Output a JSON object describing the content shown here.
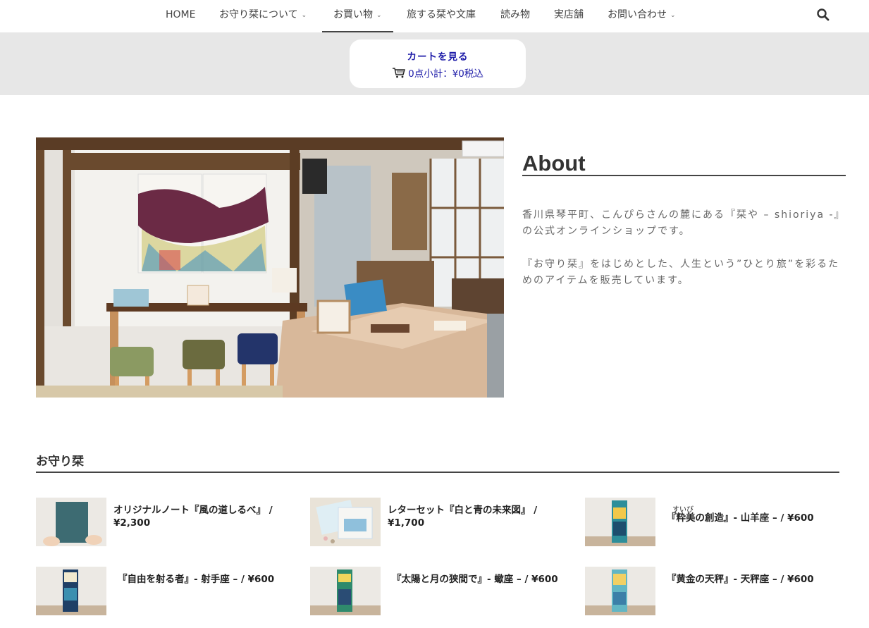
{
  "nav": {
    "items": [
      {
        "label": "HOME"
      },
      {
        "label": "お守り栞について"
      },
      {
        "label": "お買い物"
      },
      {
        "label": "旅する栞や文庫"
      },
      {
        "label": "読み物"
      },
      {
        "label": "実店舗"
      },
      {
        "label": "お問い合わせ"
      }
    ],
    "active": "お買い物",
    "search_icon": "search-icon"
  },
  "cart": {
    "title": "カートを見る",
    "summary": "0点小計：¥0税込",
    "icon": "cart-icon",
    "color": "#1d1ba8"
  },
  "about": {
    "title": "About",
    "paragraph1": "香川県琴平町、こんぴらさんの麓にある『栞や – shioriya -』の公式オンラインショップです。",
    "paragraph2": "『お守り栞』をはじめとした、人生という”ひとり旅”を彩るためのアイテムを販売しています。"
  },
  "section": {
    "title": "お守り栞"
  },
  "products": [
    {
      "name": "オリジナルノート『風の道しるべ』 / ¥2,300"
    },
    {
      "name": "レターセット『白と青の未来図』 / ¥1,700"
    },
    {
      "name": "『粋美の創造』- 山羊座 – / ¥600",
      "ruby": "すいび"
    },
    {
      "name": "『自由を射る者』- 射手座 – / ¥600"
    },
    {
      "name": "『太陽と月の狭間で』- 蠍座 – / ¥600"
    },
    {
      "name": "『黄金の天秤』- 天秤座 – / ¥600"
    }
  ]
}
